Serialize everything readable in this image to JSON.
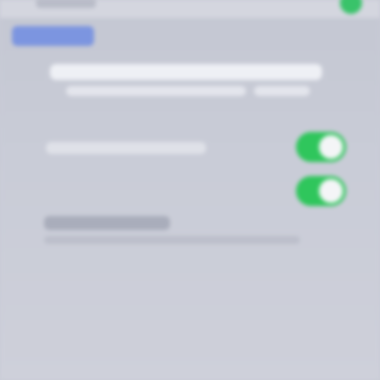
{
  "status_bar": {
    "time": "",
    "indicator_color": "#39c36a"
  },
  "nav": {
    "back_label": ""
  },
  "header": {
    "line1": "",
    "line2": ""
  },
  "settings": [
    {
      "label": "",
      "enabled": true,
      "toggle_color": "#2fc65c"
    },
    {
      "label": "",
      "enabled": true,
      "toggle_color": "#2fc65c"
    }
  ],
  "section": {
    "title": "",
    "description": ""
  },
  "colors": {
    "background": "#c9ccd7",
    "accent": "#7c95e0",
    "toggle_on": "#2fc65c"
  }
}
